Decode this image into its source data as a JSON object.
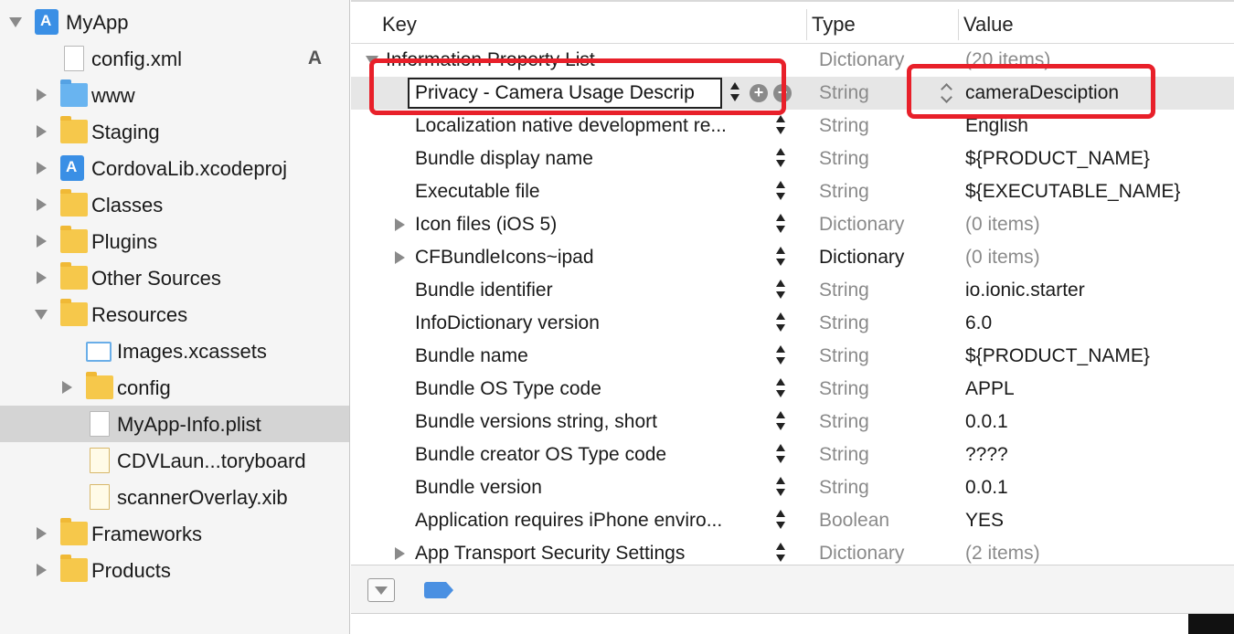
{
  "colors": {
    "annotation": "#e8202a",
    "selection": "#d4d4d4",
    "folder": "#f6c84b",
    "accent": "#4a90e2"
  },
  "navigator": {
    "items": [
      {
        "label": "MyApp",
        "icon": "xcodeproj-icon",
        "disclosure": "open",
        "indent": 0
      },
      {
        "label": "config.xml",
        "icon": "file-icon",
        "disclosure": "none",
        "indent": 1,
        "badge": "A"
      },
      {
        "label": "www",
        "icon": "blue-folder-icon",
        "disclosure": "closed",
        "indent": 1
      },
      {
        "label": "Staging",
        "icon": "folder-icon",
        "disclosure": "closed",
        "indent": 1
      },
      {
        "label": "CordovaLib.xcodeproj",
        "icon": "xcodeproj-icon",
        "disclosure": "closed",
        "indent": 1
      },
      {
        "label": "Classes",
        "icon": "folder-icon",
        "disclosure": "closed",
        "indent": 1
      },
      {
        "label": "Plugins",
        "icon": "folder-icon",
        "disclosure": "closed",
        "indent": 1
      },
      {
        "label": "Other Sources",
        "icon": "folder-icon",
        "disclosure": "closed",
        "indent": 1
      },
      {
        "label": "Resources",
        "icon": "folder-icon",
        "disclosure": "open",
        "indent": 1
      },
      {
        "label": "Images.xcassets",
        "icon": "asset-catalog-icon",
        "disclosure": "none",
        "indent": 2
      },
      {
        "label": "config",
        "icon": "folder-icon",
        "disclosure": "closed",
        "indent": 2
      },
      {
        "label": "MyApp-Info.plist",
        "icon": "plist-file-icon",
        "disclosure": "none",
        "indent": 2,
        "selected": true
      },
      {
        "label": "CDVLaun...toryboard",
        "icon": "storyboard-icon",
        "disclosure": "none",
        "indent": 2
      },
      {
        "label": "scannerOverlay.xib",
        "icon": "xib-icon",
        "disclosure": "none",
        "indent": 2
      },
      {
        "label": "Frameworks",
        "icon": "folder-icon",
        "disclosure": "closed",
        "indent": 1
      },
      {
        "label": "Products",
        "icon": "folder-icon",
        "disclosure": "closed",
        "indent": 1
      }
    ]
  },
  "editor": {
    "columns": {
      "key": "Key",
      "type": "Type",
      "value": "Value"
    },
    "root": {
      "key": "Information Property List",
      "type": "Dictionary",
      "value": "(20 items)"
    },
    "editing_row": {
      "key": "Privacy - Camera Usage Descrip",
      "type": "String",
      "value": "cameraDesciption"
    },
    "rows": [
      {
        "key": "Localization native development re...",
        "type": "String",
        "value": "English",
        "expandable": false
      },
      {
        "key": "Bundle display name",
        "type": "String",
        "value": "${PRODUCT_NAME}",
        "expandable": false
      },
      {
        "key": "Executable file",
        "type": "String",
        "value": "${EXECUTABLE_NAME}",
        "expandable": false
      },
      {
        "key": "Icon files (iOS 5)",
        "type": "Dictionary",
        "value": "(0 items)",
        "expandable": true
      },
      {
        "key": "CFBundleIcons~ipad",
        "type": "Dictionary",
        "value": "(0 items)",
        "expandable": true,
        "dark_type": true
      },
      {
        "key": "Bundle identifier",
        "type": "String",
        "value": "io.ionic.starter",
        "expandable": false
      },
      {
        "key": "InfoDictionary version",
        "type": "String",
        "value": "6.0",
        "expandable": false
      },
      {
        "key": "Bundle name",
        "type": "String",
        "value": "${PRODUCT_NAME}",
        "expandable": false
      },
      {
        "key": "Bundle OS Type code",
        "type": "String",
        "value": "APPL",
        "expandable": false
      },
      {
        "key": "Bundle versions string, short",
        "type": "String",
        "value": "0.0.1",
        "expandable": false
      },
      {
        "key": "Bundle creator OS Type code",
        "type": "String",
        "value": "????",
        "expandable": false
      },
      {
        "key": "Bundle version",
        "type": "String",
        "value": "0.0.1",
        "expandable": false
      },
      {
        "key": "Application requires iPhone enviro...",
        "type": "Boolean",
        "value": "YES",
        "expandable": false
      },
      {
        "key": "App Transport Security Settings",
        "type": "Dictionary",
        "value": "(2 items)",
        "expandable": true
      }
    ]
  }
}
